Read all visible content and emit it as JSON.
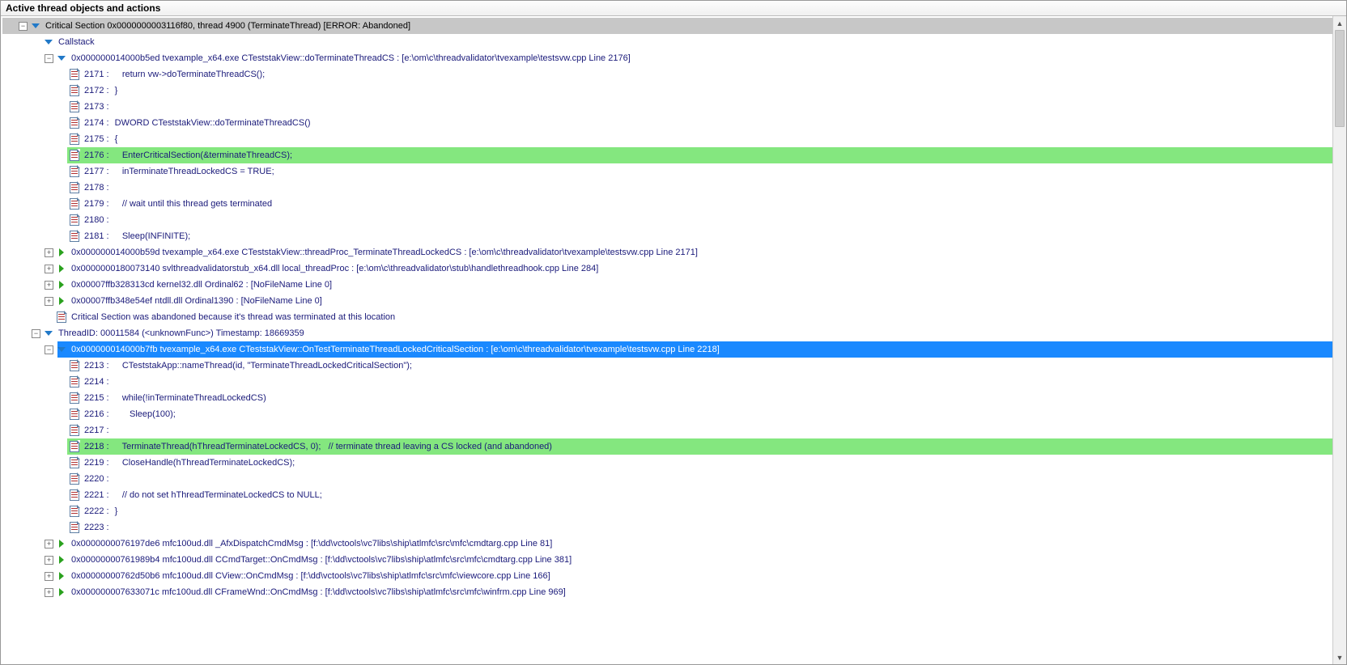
{
  "title": "Active thread objects and actions",
  "tree": {
    "critical_section": "Critical Section 0x0000000003116f80, thread 4900 (TerminateThread) [ERROR: Abandoned]",
    "callstack_label": "Callstack",
    "frame1": "0x000000014000b5ed tvexample_x64.exe CTeststakView::doTerminateThreadCS : [e:\\om\\c\\threadvalidator\\tvexample\\testsvw.cpp Line 2176]",
    "src1": [
      {
        "ln": "2171 :",
        "code": "    return vw->doTerminateThreadCS();",
        "hl": false
      },
      {
        "ln": "2172 :",
        "code": " }",
        "hl": false
      },
      {
        "ln": "2173 :",
        "code": "",
        "hl": false
      },
      {
        "ln": "2174 :",
        "code": " DWORD CTeststakView::doTerminateThreadCS()",
        "hl": false
      },
      {
        "ln": "2175 :",
        "code": " {",
        "hl": false
      },
      {
        "ln": "2176 :",
        "code": "    EnterCriticalSection(&terminateThreadCS);",
        "hl": true
      },
      {
        "ln": "2177 :",
        "code": "    inTerminateThreadLockedCS = TRUE;",
        "hl": false
      },
      {
        "ln": "2178 :",
        "code": "",
        "hl": false
      },
      {
        "ln": "2179 :",
        "code": "    // wait until this thread gets terminated",
        "hl": false
      },
      {
        "ln": "2180 :",
        "code": "",
        "hl": false
      },
      {
        "ln": "2181 :",
        "code": "    Sleep(INFINITE);",
        "hl": false
      }
    ],
    "frame2": "0x000000014000b59d tvexample_x64.exe CTeststakView::threadProc_TerminateThreadLockedCS : [e:\\om\\c\\threadvalidator\\tvexample\\testsvw.cpp Line 2171]",
    "frame3": "0x0000000180073140 svlthreadvalidatorstub_x64.dll local_threadProc : [e:\\om\\c\\threadvalidator\\stub\\handlethreadhook.cpp Line 284]",
    "frame4": "0x00007ffb328313cd kernel32.dll Ordinal62 : [NoFileName Line 0]",
    "frame5": "0x00007ffb348e54ef ntdll.dll Ordinal1390 : [NoFileName Line 0]",
    "abandoned_note": "Critical Section was abandoned because it's thread was terminated at this location",
    "thread_id": "ThreadID: 00011584 (<unknownFunc>) Timestamp: 18669359",
    "frame6_selected": "0x000000014000b7fb tvexample_x64.exe CTeststakView::OnTestTerminateThreadLockedCriticalSection : [e:\\om\\c\\threadvalidator\\tvexample\\testsvw.cpp Line 2218]",
    "src2": [
      {
        "ln": "2213 :",
        "code": "    CTeststakApp::nameThread(id, \"TerminateThreadLockedCriticalSection\");",
        "hl": false
      },
      {
        "ln": "2214 :",
        "code": "",
        "hl": false
      },
      {
        "ln": "2215 :",
        "code": "    while(!inTerminateThreadLockedCS)",
        "hl": false
      },
      {
        "ln": "2216 :",
        "code": "       Sleep(100);",
        "hl": false
      },
      {
        "ln": "2217 :",
        "code": "",
        "hl": false
      },
      {
        "ln": "2218 :",
        "code": "    TerminateThread(hThreadTerminateLockedCS, 0);   // terminate thread leaving a CS locked (and abandoned)",
        "hl": true
      },
      {
        "ln": "2219 :",
        "code": "    CloseHandle(hThreadTerminateLockedCS);",
        "hl": false
      },
      {
        "ln": "2220 :",
        "code": "",
        "hl": false
      },
      {
        "ln": "2221 :",
        "code": "    // do not set hThreadTerminateLockedCS to NULL;",
        "hl": false
      },
      {
        "ln": "2222 :",
        "code": " }",
        "hl": false
      },
      {
        "ln": "2223 :",
        "code": "",
        "hl": false
      }
    ],
    "frame7": "0x0000000076197de6 mfc100ud.dll _AfxDispatchCmdMsg : [f:\\dd\\vctools\\vc7libs\\ship\\atlmfc\\src\\mfc\\cmdtarg.cpp Line 81]",
    "frame8": "0x00000000761989b4 mfc100ud.dll CCmdTarget::OnCmdMsg : [f:\\dd\\vctools\\vc7libs\\ship\\atlmfc\\src\\mfc\\cmdtarg.cpp Line 381]",
    "frame9": "0x00000000762d50b6 mfc100ud.dll CView::OnCmdMsg : [f:\\dd\\vctools\\vc7libs\\ship\\atlmfc\\src\\mfc\\viewcore.cpp Line 166]",
    "frame10": "0x000000007633071c mfc100ud.dll CFrameWnd::OnCmdMsg : [f:\\dd\\vctools\\vc7libs\\ship\\atlmfc\\src\\mfc\\winfrm.cpp Line 969]"
  }
}
